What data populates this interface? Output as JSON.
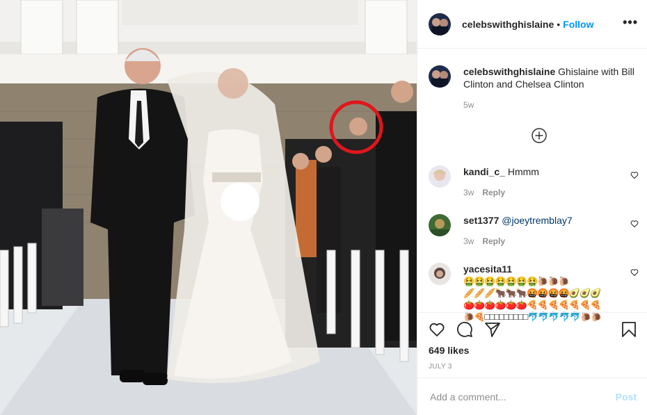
{
  "post": {
    "username": "celebswithghislaine",
    "follow_label": "Follow",
    "separator": "•",
    "more_label": "•••",
    "caption_user": "celebswithghislaine",
    "caption_text": "Ghislaine with Bill Clinton and Chelsea Clinton",
    "caption_time": "5w",
    "likes": "649 likes",
    "date": "JULY 3"
  },
  "comments": [
    {
      "user": "kandi_c_",
      "text": "Hmmm",
      "time": "3w",
      "reply": "Reply"
    },
    {
      "user": "set1377",
      "text": "@joeytremblay7",
      "time": "3w",
      "reply": "Reply"
    },
    {
      "user": "yacesita11",
      "text": "",
      "emoji_lines": [
        "🤮🤮🤮🤮🤮🤮🤮🐌🐌🐌",
        "🥖🥖🥖🐂🐂🐂🤬🤬🤬🤬🥑🥑🥑",
        "🍅🍅🍅🍅🍅🍅🍕🍕🍕🍕🍕🍕🍕",
        "🐌🍕□□□□□□□□□🐬🐬🐬🐬🐬🐌🐌"
      ]
    }
  ],
  "add_comment": {
    "placeholder": "Add a comment...",
    "post_label": "Post"
  },
  "icons": [
    "heart-icon",
    "comment-icon",
    "share-icon",
    "bookmark-icon",
    "add-circle-icon",
    "more-icon"
  ],
  "colors": {
    "link": "#0095f6",
    "muted": "#8e8e8e",
    "post_disabled": "#b2dffc",
    "circle": "#e0161b"
  }
}
